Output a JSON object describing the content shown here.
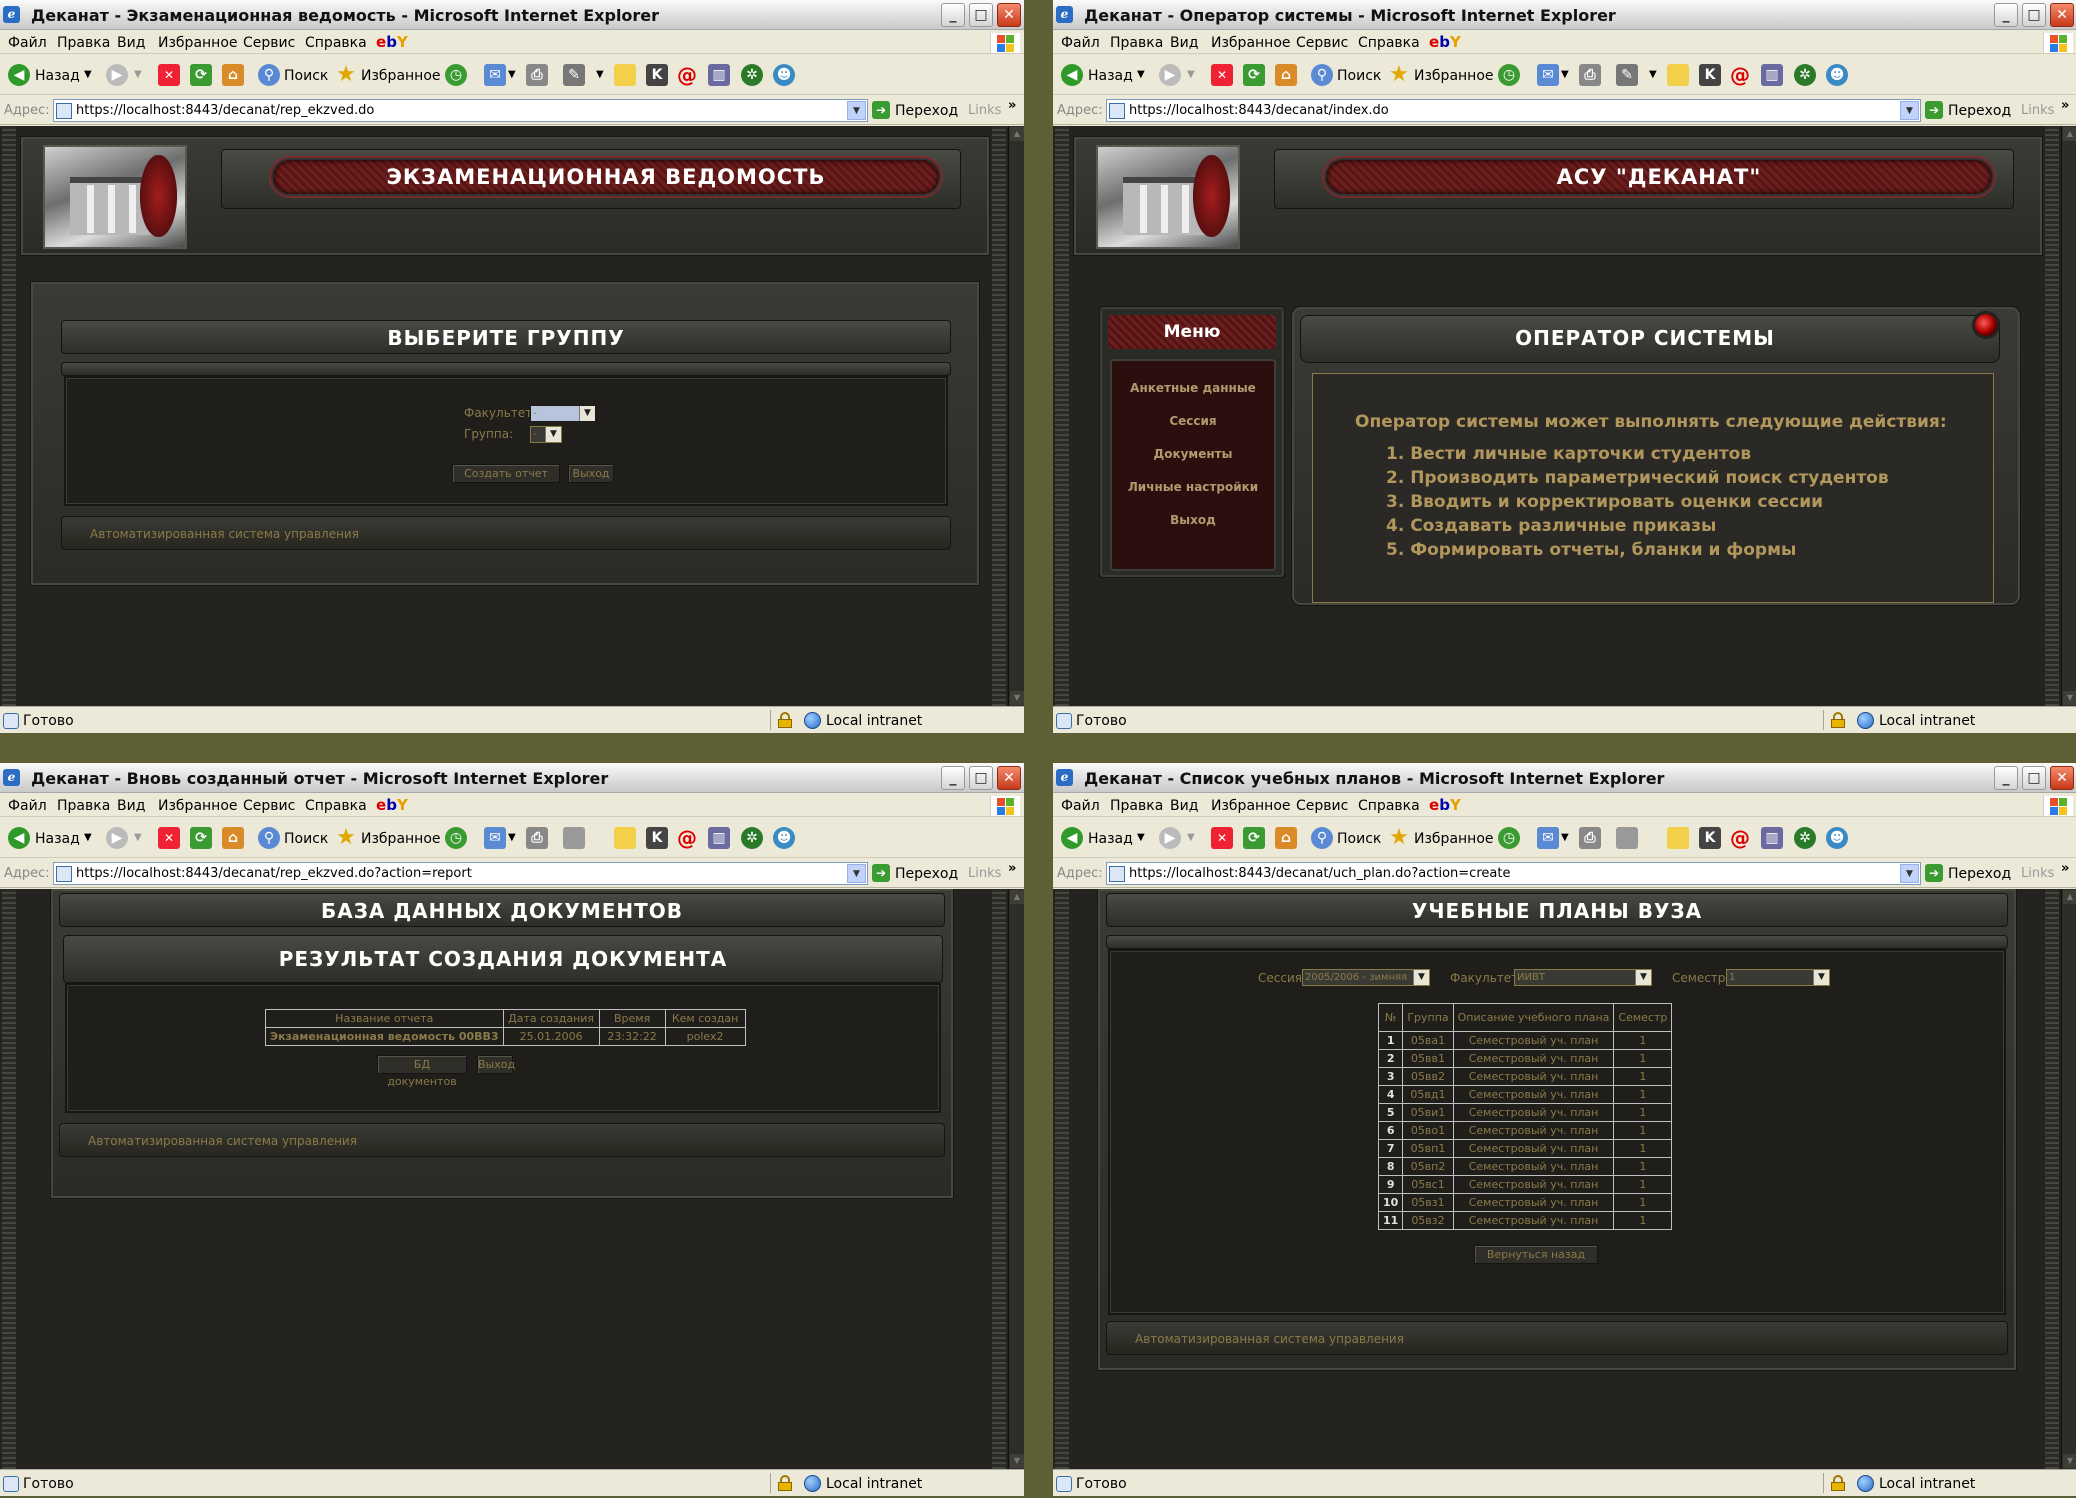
{
  "browser": {
    "menu": [
      "Файл",
      "Правка",
      "Вид",
      "Избранное",
      "Сервис",
      "Справка"
    ],
    "back_label": "Назад",
    "search_label": "Поиск",
    "favorites_label": "Избранное",
    "address_label": "Адрес:",
    "go_label": "Переход",
    "links_label": "Links",
    "links_more": "»",
    "status_ready": "Готово",
    "zone": "Local intranet"
  },
  "w1": {
    "title": "Деканат - Экзаменационная ведомость - Microsoft Internet Explorer",
    "url": "https://localhost:8443/decanat/rep_ekzved.do",
    "header": "ЭКЗАМЕНАЦИОННАЯ ВЕДОМОСТЬ",
    "panel_title": "ВЫБЕРИТЕ ГРУППУ",
    "faculty_label": "Факультет:",
    "faculty_value": "-",
    "group_label": "Группа:",
    "group_value": "-",
    "create_btn": "Создать отчет",
    "exit_btn": "Выход",
    "footer": "Автоматизированная система управления"
  },
  "w2": {
    "title": "Деканат - Оператор системы - Microsoft Internet Explorer",
    "url": "https://localhost:8443/decanat/index.do",
    "header": "АСУ \"ДЕКАНАТ\"",
    "menu_title": "Меню",
    "menu_items": [
      "Анкетные данные",
      "Сессия",
      "Документы",
      "Личные настройки",
      "Выход"
    ],
    "panel_title": "ОПЕРАТОР СИСТЕМЫ",
    "intro": "Оператор системы может выполнять следующие действия:",
    "actions": [
      "1. Вести личные карточки студентов",
      "2. Производить параметрический поиск студентов",
      "3. Вводить и корректировать оценки сессии",
      "4. Создавать различные приказы",
      "5. Формировать отчеты, бланки и формы"
    ]
  },
  "w3": {
    "title": "Деканат - Вновь созданный отчет - Microsoft Internet Explorer",
    "url": "https://localhost:8443/decanat/rep_ekzved.do?action=report",
    "header": "БАЗА ДАННЫХ ДОКУМЕНТОВ",
    "panel_title": "РЕЗУЛЬТАТ СОЗДАНИЯ ДОКУМЕНТА",
    "columns": [
      "Название отчета",
      "Дата создания",
      "Время",
      "Кем создан"
    ],
    "row": [
      "Экзаменационная ведомость 00ВВ3",
      "25.01.2006",
      "23:32:22",
      "polex2"
    ],
    "db_btn": "БД документов",
    "exit_btn": "Выход",
    "footer": "Автоматизированная система управления"
  },
  "w4": {
    "title": "Деканат - Список учебных планов - Microsoft Internet Explorer",
    "url": "https://localhost:8443/decanat/uch_plan.do?action=create",
    "header": "УЧЕБНЫЕ ПЛАНЫ ВУЗА",
    "session_label": "Сессия:",
    "session_value": "2005/2006 - зимняя",
    "faculty_label": "Факультет:",
    "faculty_value": "ИИВТ",
    "semester_label": "Семестр:",
    "semester_value": "1",
    "columns": [
      "№",
      "Группа",
      "Описание учебного плана",
      "Семестр"
    ],
    "rows": [
      [
        "1",
        "05ва1",
        "Семестровый уч. план",
        "1"
      ],
      [
        "2",
        "05вв1",
        "Семестровый уч. план",
        "1"
      ],
      [
        "3",
        "05вв2",
        "Семестровый уч. план",
        "1"
      ],
      [
        "4",
        "05вд1",
        "Семестровый уч. план",
        "1"
      ],
      [
        "5",
        "05ви1",
        "Семестровый уч. план",
        "1"
      ],
      [
        "6",
        "05во1",
        "Семестровый уч. план",
        "1"
      ],
      [
        "7",
        "05вп1",
        "Семестровый уч. план",
        "1"
      ],
      [
        "8",
        "05вп2",
        "Семестровый уч. план",
        "1"
      ],
      [
        "9",
        "05вс1",
        "Семестровый уч. план",
        "1"
      ],
      [
        "10",
        "05вз1",
        "Семестровый уч. план",
        "1"
      ],
      [
        "11",
        "05вз2",
        "Семестровый уч. план",
        "1"
      ]
    ],
    "back_btn": "Вернуться назад",
    "footer": "Автоматизированная система управления"
  }
}
